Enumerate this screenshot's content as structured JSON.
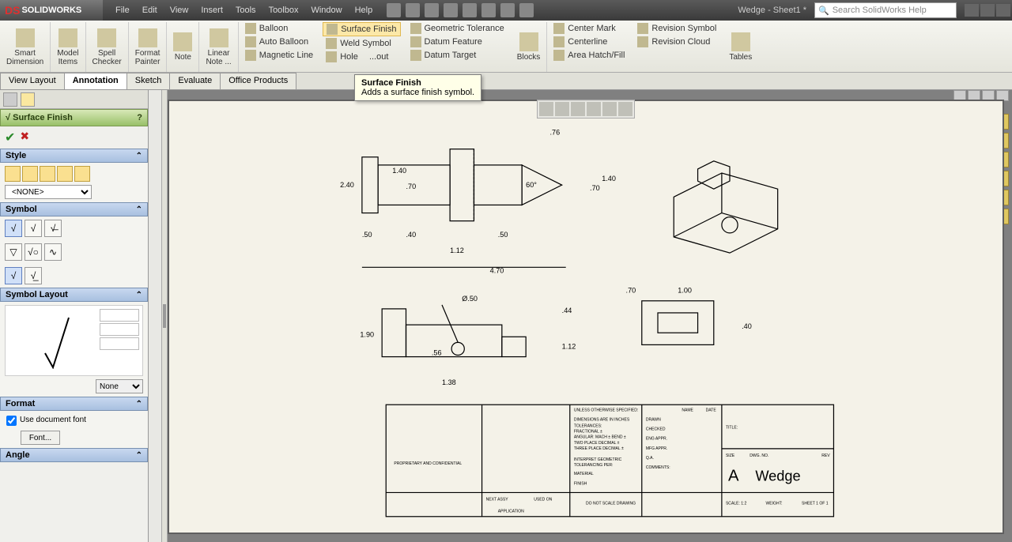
{
  "app": {
    "name": "SOLIDWORKS",
    "doc_title": "Wedge - Sheet1 *",
    "search_placeholder": "Search SolidWorks Help"
  },
  "menus": [
    "File",
    "Edit",
    "View",
    "Insert",
    "Tools",
    "Toolbox",
    "Window",
    "Help"
  ],
  "ribbon": {
    "big": [
      {
        "label": "Smart\nDimension"
      },
      {
        "label": "Model\nItems"
      },
      {
        "label": "Spell\nChecker"
      },
      {
        "label": "Format\nPainter"
      },
      {
        "label": "Note"
      },
      {
        "label": "Linear\nNote ..."
      }
    ],
    "col1": [
      "Balloon",
      "Auto Balloon",
      "Magnetic Line"
    ],
    "col2": [
      "Surface Finish",
      "Weld Symbol",
      "Hole"
    ],
    "col2b": "...out",
    "col3": [
      "Geometric Tolerance",
      "Datum Feature",
      "Datum Target"
    ],
    "blocks": "Blocks",
    "col4": [
      "Center Mark",
      "Centerline",
      "Area Hatch/Fill"
    ],
    "col5": [
      "Revision Symbol",
      "Revision Cloud"
    ],
    "tables": "Tables"
  },
  "tabs": [
    "View Layout",
    "Annotation",
    "Sketch",
    "Evaluate",
    "Office Products"
  ],
  "active_tab": "Annotation",
  "tooltip": {
    "title": "Surface Finish",
    "desc": "Adds a surface finish symbol."
  },
  "prop": {
    "title": "Surface Finish",
    "sections": {
      "style": "Style",
      "symbol": "Symbol",
      "layout": "Symbol Layout",
      "format": "Format",
      "angle": "Angle"
    },
    "style_select": "<NONE>",
    "none_select": "None",
    "use_doc_font": "Use document font",
    "font_btn": "Font..."
  },
  "drawing": {
    "dims_top": {
      "d76": ".76",
      "d240": "2.40",
      "d140a": "1.40",
      "d70a": ".70",
      "d60deg": "60°",
      "d140b": "1.40",
      "d70b": ".70",
      "d50a": ".50",
      "d40": ".40",
      "d50b": ".50",
      "d112a": "1.12",
      "d470": "4.70"
    },
    "dims_mid": {
      "dia50": "Ø.50",
      "d190": "1.90",
      "d56": ".56",
      "d44": ".44",
      "d112b": "1.12",
      "d138": "1.38",
      "d70c": ".70",
      "d100": "1.00",
      "d40b": ".40"
    },
    "titleblock": {
      "unless": "UNLESS OTHERWISE SPECIFIED:",
      "dims_in": "DIMENSIONS ARE IN INCHES",
      "tol": "TOLERANCES:",
      "frac": "FRACTIONAL ±",
      "ang": "ANGULAR: MACH ±  BEND ±",
      "two": "TWO PLACE DECIMAL    ±",
      "three": "THREE PLACE DECIMAL  ±",
      "interp": "INTERPRET GEOMETRIC",
      "tolper": "TOLERANCING PER:",
      "material": "MATERIAL",
      "finish": "FINISH",
      "dns": "DO NOT SCALE DRAWING",
      "prop_conf": "PROPRIETARY AND CONFIDENTIAL",
      "name": "NAME",
      "date": "DATE",
      "drawn": "DRAWN",
      "checked": "CHECKED",
      "eng": "ENG APPR.",
      "mfg": "MFG APPR.",
      "qa": "Q.A.",
      "comments": "COMMENTS:",
      "title_lbl": "TITLE:",
      "size": "SIZE",
      "sizeA": "A",
      "dwgno": "DWG.  NO.",
      "rev": "REV",
      "partname": "Wedge",
      "scale": "SCALE: 1:2",
      "weight": "WEIGHT:",
      "sheet": "SHEET 1 OF 1",
      "next": "NEXT ASSY",
      "used": "USED ON",
      "app": "APPLICATION"
    }
  }
}
